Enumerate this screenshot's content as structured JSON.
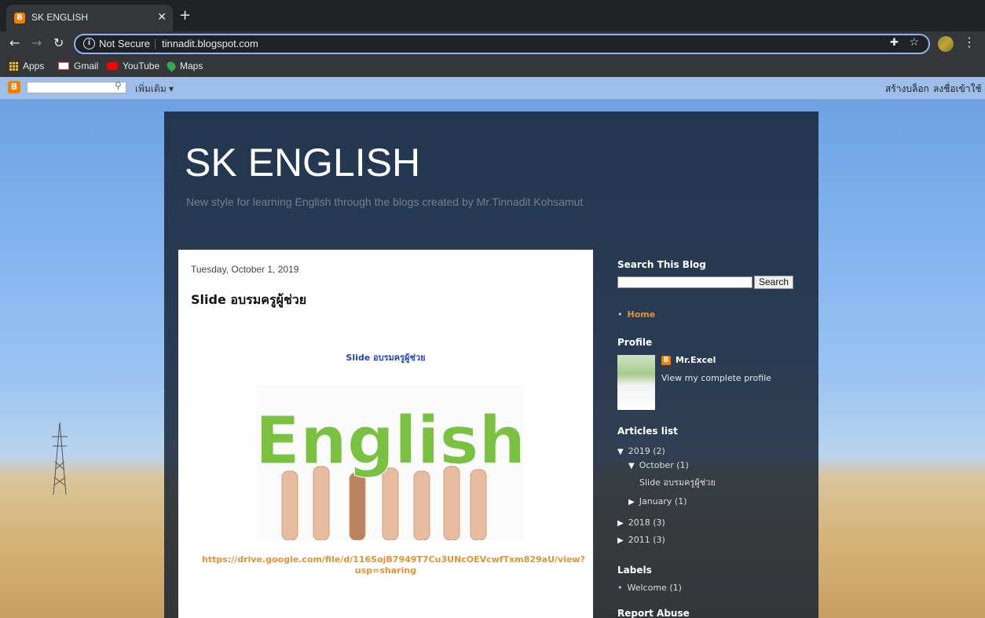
{
  "browser": {
    "tab_title": "SK ENGLISH",
    "tab_favicon": "B",
    "new_tab": "+",
    "not_secure": "Not Secure",
    "url": "tinnadit.blogspot.com",
    "bookmarks": [
      "Apps",
      "Gmail",
      "YouTube",
      "Maps"
    ]
  },
  "blogger_bar": {
    "more": "เพิ่มเติม ▾",
    "create": "สร้างบล็อก",
    "signin": "ลงชื่อเข้าใช้"
  },
  "header": {
    "title": "SK ENGLISH",
    "description": "New style for learning English through the blogs created by Mr.Tinnadit Kohsamut"
  },
  "post": {
    "date": "Tuesday, October 1, 2019",
    "title": "Slide อบรมครูผู้ช่วย",
    "link_text": "Slide อบรมครูผู้ช่วย",
    "image_text": "English",
    "url": "https://drive.google.com/file/d/116SojB7949T7Cu3UNcOEVcwfTxm829aU/view?usp=sharing"
  },
  "sidebar": {
    "search_heading": "Search This Blog",
    "search_button": "Search",
    "home": "Home",
    "profile_heading": "Profile",
    "profile_name": "Mr.Excel",
    "profile_link": "View my complete profile",
    "articles_heading": "Articles list",
    "archive": {
      "y2019": "2019 (2)",
      "oct": "October (1)",
      "post": "Slide อบรมครูผู้ช่วย",
      "jan": "January (1)",
      "y2018": "2018 (3)",
      "y2011": "2011 (3)"
    },
    "labels_heading": "Labels",
    "label_welcome": "Welcome (1)",
    "report_heading": "Report Abuse"
  }
}
